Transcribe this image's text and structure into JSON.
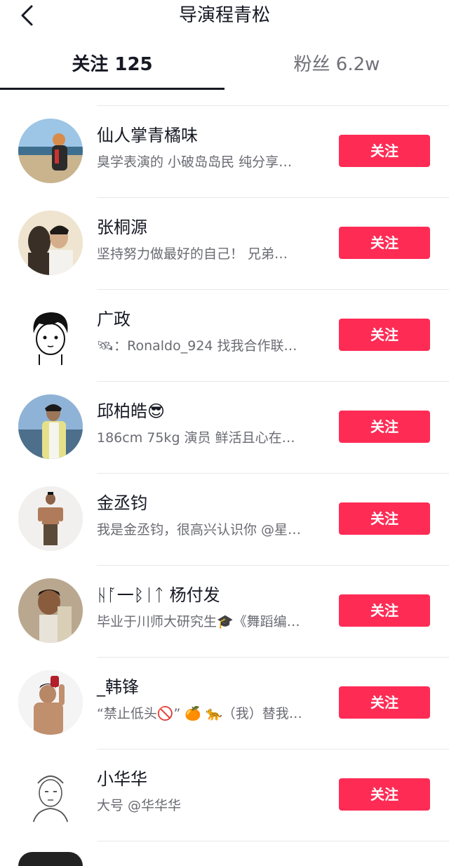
{
  "header": {
    "title": "导演程青松",
    "back_icon": "chevron-left-icon"
  },
  "tabs": [
    {
      "label": "关注 125",
      "active": true
    },
    {
      "label": "粉丝 6.2w",
      "active": false
    }
  ],
  "colors": {
    "accent": "#fe2c55",
    "text_primary": "#161823",
    "text_secondary": "#6a6b73"
  },
  "users": [
    {
      "name": "仙人掌青橘味",
      "bio": "臭学表演的 小破岛岛民 纯分享…",
      "button": "关注"
    },
    {
      "name": "张桐源",
      "bio": "坚持努力做最好的自己！ 兄弟…",
      "button": "关注"
    },
    {
      "name": "广政",
      "bio": "🛰：Ronaldo_924 找我合作联…",
      "button": "关注"
    },
    {
      "name": "邱柏皓😎",
      "bio": "186cm 75kg 演员  鲜活且心在…",
      "button": "关注"
    },
    {
      "name": "金丞钧",
      "bio": "我是金丞钧，很高兴认识你 @星…",
      "button": "关注"
    },
    {
      "name": "ᚺᚪ一ᛒᛁᛏ 杨付发",
      "bio": "毕业于川师大研究生🎓《舞蹈编…",
      "button": "关注"
    },
    {
      "name": "_韩锋",
      "bio": "“禁止低头🚫” 🍊 🐆（我）替我…",
      "button": "关注"
    },
    {
      "name": "小华华",
      "bio": "大号 @华华华",
      "button": "关注"
    }
  ]
}
